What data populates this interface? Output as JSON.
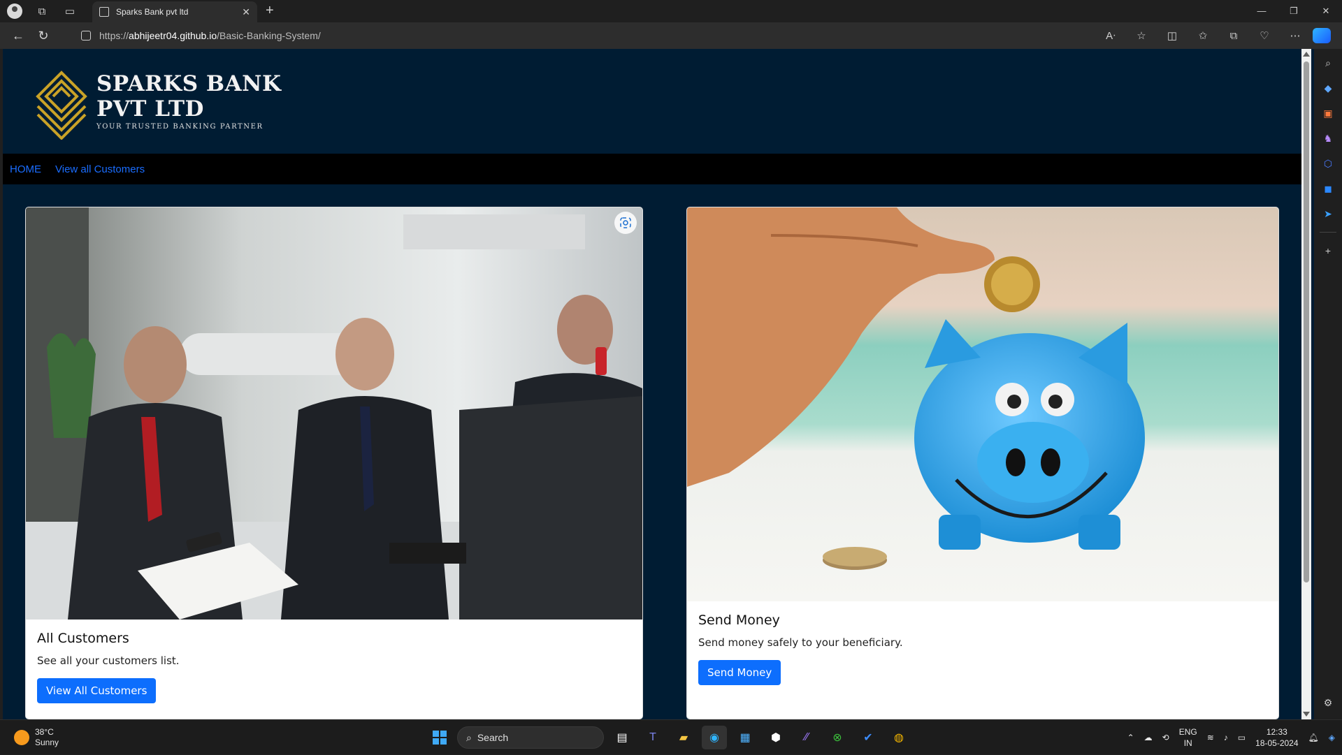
{
  "browser": {
    "tab_title": "Sparks Bank pvt ltd",
    "url_scheme": "https://",
    "url_host": "abhijeetr04.github.io",
    "url_path": "/Basic-Banking-System/"
  },
  "site": {
    "brand_line1": "SPARKS BANK",
    "brand_line2": "PVT LTD",
    "tagline": "YOUR TRUSTED BANKING PARTNER",
    "nav": [
      {
        "label": "HOME"
      },
      {
        "label": "View all Customers"
      }
    ],
    "cards": [
      {
        "title": "All Customers",
        "text": "See all your customers list.",
        "button": "View All Customers",
        "image": "office-meeting-photo"
      },
      {
        "title": "Send Money",
        "text": "Send money safely to your beneficiary.",
        "button": "Send Money",
        "image": "piggy-bank-photo"
      }
    ]
  },
  "taskbar": {
    "weather_temp": "38°C",
    "weather_desc": "Sunny",
    "search_label": "Search",
    "lang_line1": "ENG",
    "lang_line2": "IN",
    "time": "12:33",
    "date": "18-05-2024"
  },
  "colors": {
    "page_bg": "#001c33",
    "nav_bg": "#000000",
    "link": "#1a6dff",
    "button": "#0d6efd",
    "logo_gold": "#c9a227"
  }
}
